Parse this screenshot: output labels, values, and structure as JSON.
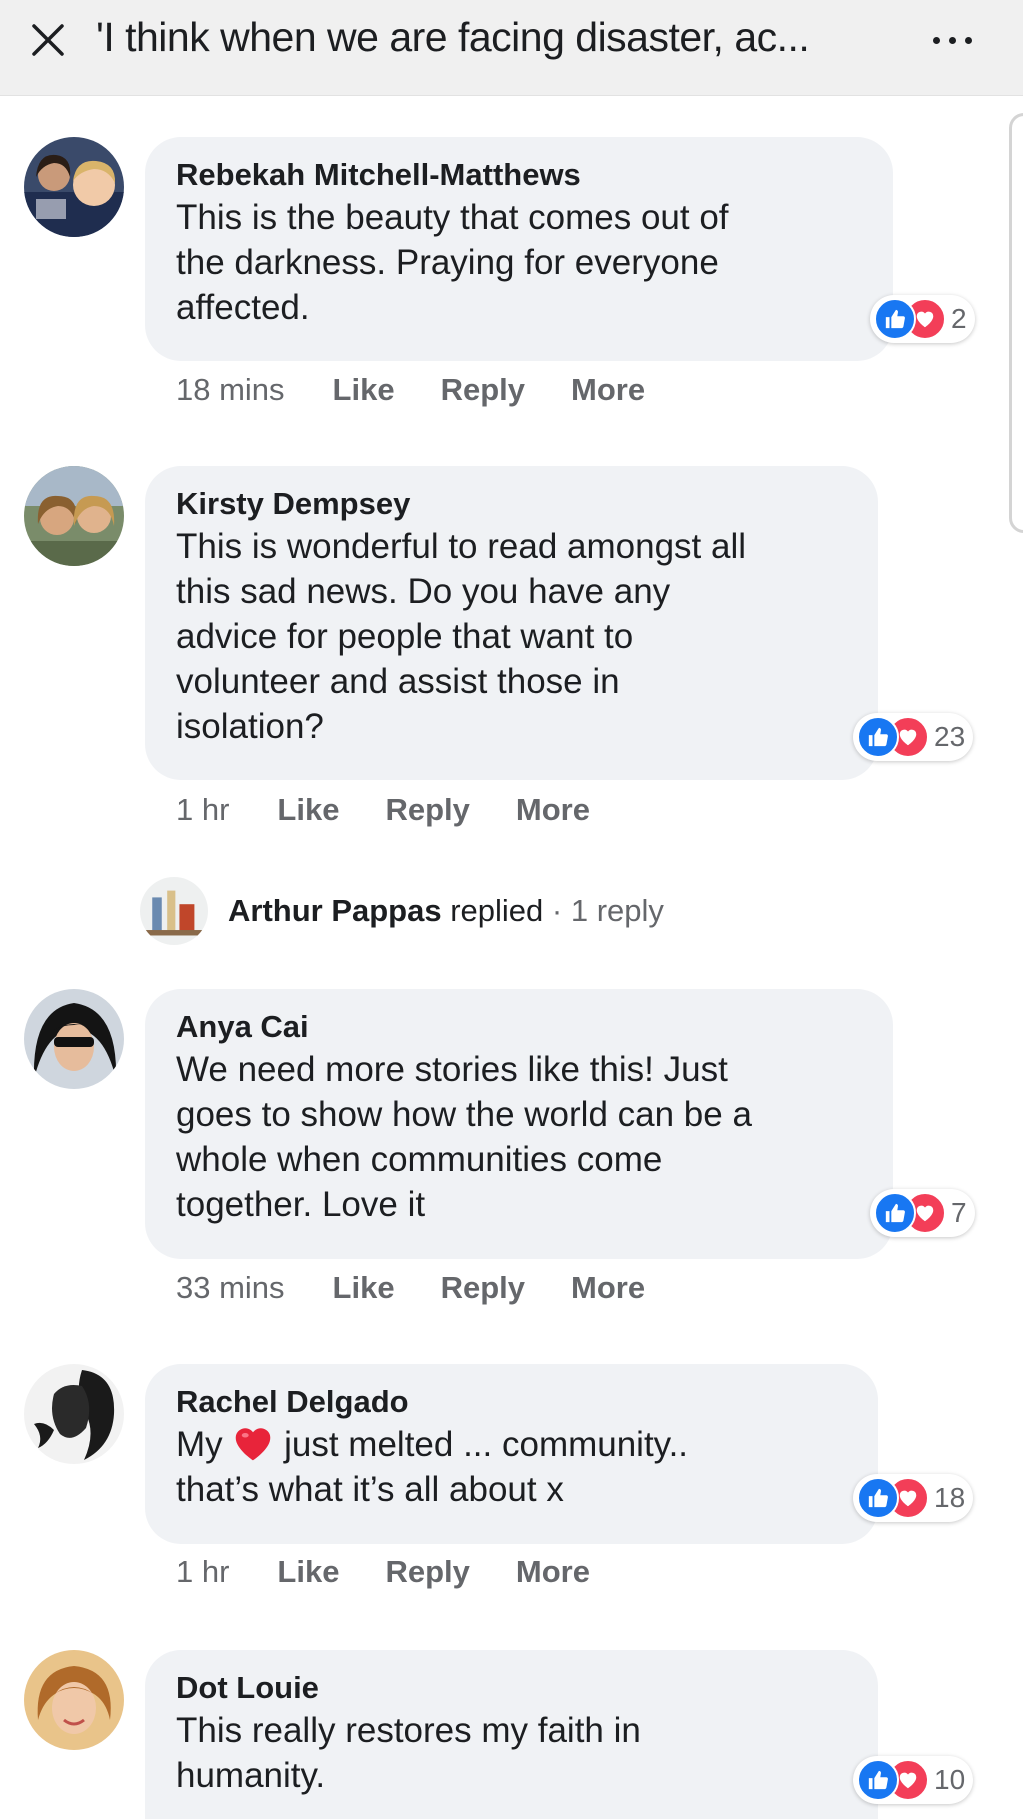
{
  "header": {
    "title": "'I think when we are facing disaster, ac...",
    "close_icon": "close-icon",
    "menu_icon": "more-dots-icon"
  },
  "colors": {
    "like_blue": "#1877f2",
    "love_red": "#f33e58",
    "bubble_gray": "#f0f2f5",
    "meta_gray": "#65676b"
  },
  "comments": [
    {
      "author": "Rebekah Mitchell-Matthews",
      "text": "This is the beauty that comes out of\nthe darkness. Praying for everyone\naffected.",
      "reaction_count": "2",
      "time": "18 mins",
      "like": "Like",
      "reply": "Reply",
      "more": "More"
    },
    {
      "author": "Kirsty Dempsey",
      "text": "This is wonderful to read amongst all\nthis sad news. Do you have any\nadvice for people that want to\nvolunteer and assist those in\nisolation?",
      "reaction_count": "23",
      "time": "1 hr",
      "like": "Like",
      "reply": "Reply",
      "more": "More",
      "reply_summary": {
        "name": "Arthur Pappas",
        "verb": " replied",
        "separator": " · ",
        "count": "1 reply"
      }
    },
    {
      "author": "Anya Cai",
      "text": "We need more stories like this! Just\ngoes to show how the world can be a\nwhole when communities come\ntogether. Love it",
      "reaction_count": "7",
      "time": "33 mins",
      "like": "Like",
      "reply": "Reply",
      "more": "More"
    },
    {
      "author": "Rachel Delgado",
      "text_before_emoji": "My ",
      "emoji": "heart-emoji",
      "text_after_emoji": " just melted ... community..",
      "text_line2": "that’s what it’s all about x",
      "reaction_count": "18",
      "time": "1 hr",
      "like": "Like",
      "reply": "Reply",
      "more": "More"
    },
    {
      "author": "Dot Louie",
      "text": "This really restores my faith in\nhumanity.",
      "reaction_count": "10"
    }
  ]
}
